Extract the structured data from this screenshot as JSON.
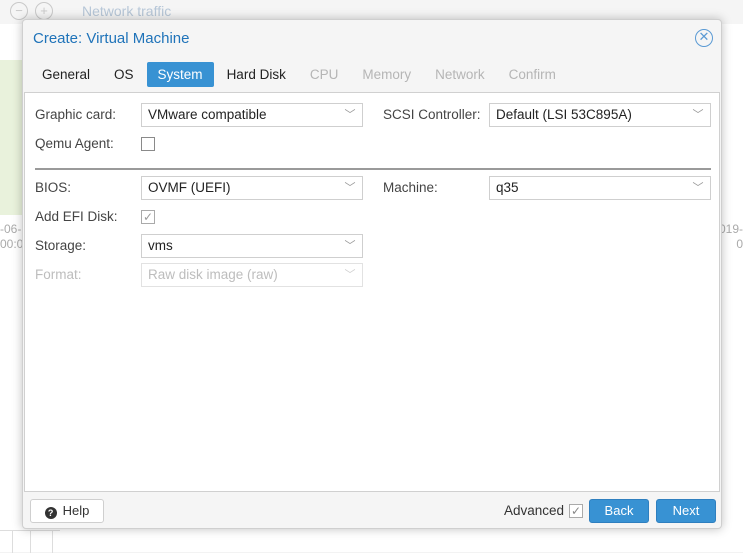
{
  "background": {
    "title": "Network traffic",
    "axis_left": [
      "-06-",
      "00:0"
    ],
    "axis_right": [
      "019-",
      "0"
    ]
  },
  "dialog": {
    "title": "Create: Virtual Machine",
    "close_icon": "close-circle-icon"
  },
  "tabs": [
    {
      "label": "General",
      "state": "normal"
    },
    {
      "label": "OS",
      "state": "normal"
    },
    {
      "label": "System",
      "state": "active"
    },
    {
      "label": "Hard Disk",
      "state": "normal"
    },
    {
      "label": "CPU",
      "state": "disabled"
    },
    {
      "label": "Memory",
      "state": "disabled"
    },
    {
      "label": "Network",
      "state": "disabled"
    },
    {
      "label": "Confirm",
      "state": "disabled"
    }
  ],
  "form": {
    "graphic_card": {
      "label": "Graphic card:",
      "value": "VMware compatible"
    },
    "scsi_controller": {
      "label": "SCSI Controller:",
      "value": "Default (LSI 53C895A)"
    },
    "qemu_agent": {
      "label": "Qemu Agent:",
      "checked": false
    },
    "bios": {
      "label": "BIOS:",
      "value": "OVMF (UEFI)"
    },
    "machine": {
      "label": "Machine:",
      "value": "q35"
    },
    "add_efi_disk": {
      "label": "Add EFI Disk:",
      "checked": true,
      "disabled": true
    },
    "storage": {
      "label": "Storage:",
      "value": "vms"
    },
    "format": {
      "label": "Format:",
      "value": "Raw disk image (raw)",
      "disabled": true
    }
  },
  "footer": {
    "help_label": "Help",
    "advanced_label": "Advanced",
    "advanced_checked": true,
    "back_label": "Back",
    "next_label": "Next"
  },
  "colors": {
    "accent": "#3892d3",
    "title": "#1f73b9"
  }
}
